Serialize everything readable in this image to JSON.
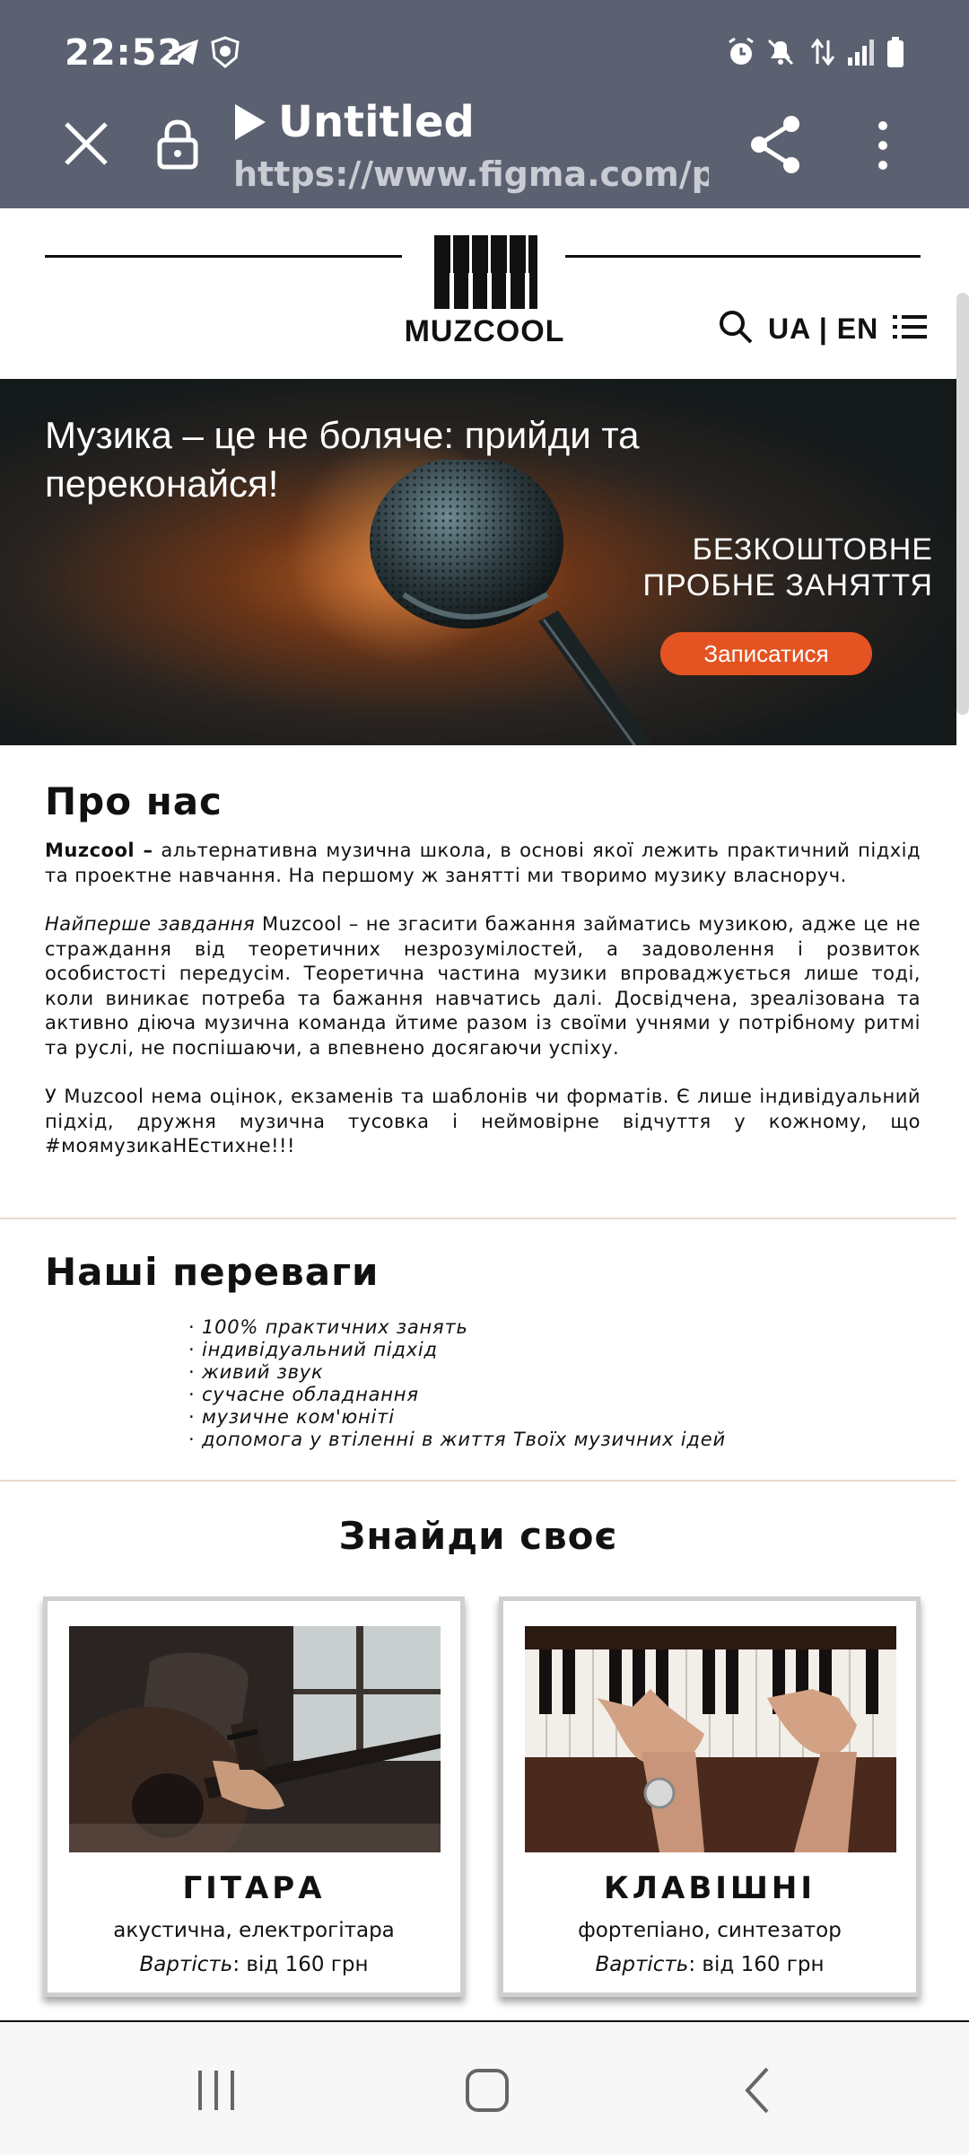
{
  "status_bar": {
    "time": "22:52",
    "icons": [
      "telegram-icon",
      "shield-app-icon",
      "alarm-icon",
      "mute-icon",
      "data-transfer-icon",
      "signal-icon",
      "battery-icon"
    ]
  },
  "browser": {
    "page_title": "Untitled",
    "url": "https://www.figma.com/prot..."
  },
  "site": {
    "brand": "MUZCOOL",
    "lang_ua": "UA",
    "lang_sep": " | ",
    "lang_en": "EN"
  },
  "hero": {
    "title": "Музика – це не боляче: прийди та переконайся!",
    "offer_line1": "БЕЗКОШТОВНЕ",
    "offer_line2": "ПРОБНЕ ЗАНЯТТЯ",
    "cta": "Записатися"
  },
  "about": {
    "heading": "Про нас",
    "p1_bold": "Muzcool –",
    "p1_rest": " альтернативна музична школа, в основі якої лежить практичний підхід та проектне навчання. На першому ж занятті ми творимо музику власноруч.",
    "p2_italic": "Найперше завдання",
    "p2_rest": " Muzcool – не згасити бажання займатись музикою, адже це не страждання від теоретичних незрозумілостей, а задоволення і розвиток особистості передусім. Теоретична частина музики впроваджується лише тоді, коли виникає потреба та бажання навчатись далі. Досвідчена, зреалізована та активно діюча музична команда йтиме разом із своїми учнями у потрібному ритмі та руслі, не поспішаючи, а впевнено досягаючи успіху.",
    "p3": "У Muzcool нема оцінок, екзаменів та шаблонів чи форматів. Є лише індивідуальний підхід, дружня музична тусовка і неймовірне відчуття у кожному, що #моямузикаНЕстихне!!!"
  },
  "advantages": {
    "heading": "Наші переваги",
    "items": [
      "100% практичних занять",
      "індивідуальний підхід",
      "живий звук",
      "сучасне обладнання",
      "музичне ком'юніті",
      "допомога у втіленні в життя Твоїх музичних ідей"
    ]
  },
  "courses": {
    "heading": "Знайди своє",
    "items": [
      {
        "name": "ГІТАРА",
        "subtitle": "акустична, електрогітара",
        "price_label": "Вартість",
        "price_value": ": від 160 грн"
      },
      {
        "name": "КЛАВІШНІ",
        "subtitle": "фортепіано, синтезатор",
        "price_label": "Вартість",
        "price_value": ": від 160 грн"
      }
    ]
  },
  "colors": {
    "chrome": "#5b6170",
    "accent": "#e35422",
    "divider": "#ead9cf"
  }
}
